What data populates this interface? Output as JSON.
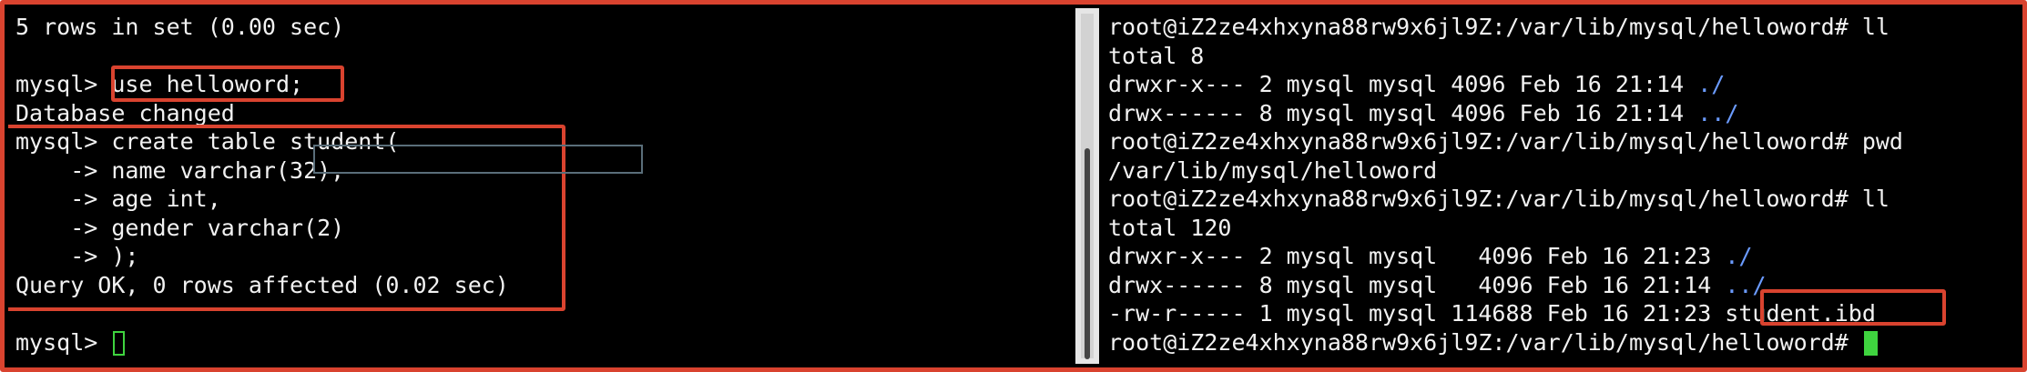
{
  "left_terminal": {
    "lines": [
      "5 rows in set (0.00 sec)",
      "",
      "mysql> use helloword;",
      "Database changed",
      "mysql> create table student(",
      "    -> name varchar(32),",
      "    -> age int,",
      "    -> gender varchar(2)",
      "    -> );",
      "Query OK, 0 rows affected (0.02 sec)",
      "",
      "mysql> "
    ]
  },
  "right_terminal": {
    "lines": [
      "root@iZ2ze4xhxyna88rw9x6jl9Z:/var/lib/mysql/helloword# ll",
      "total 8",
      "drwxr-x--- 2 mysql mysql 4096 Feb 16 21:14 ",
      "drwx------ 8 mysql mysql 4096 Feb 16 21:14 ",
      "root@iZ2ze4xhxyna88rw9x6jl9Z:/var/lib/mysql/helloword# pwd",
      "/var/lib/mysql/helloword",
      "root@iZ2ze4xhxyna88rw9x6jl9Z:/var/lib/mysql/helloword# ll",
      "total 120",
      "drwxr-x--- 2 mysql mysql   4096 Feb 16 21:23 ",
      "drwx------ 8 mysql mysql   4096 Feb 16 21:14 ",
      "-rw-r----- 1 mysql mysql 114688 Feb 16 21:23 student.ibd",
      "root@iZ2ze4xhxyna88rw9x6jl9Z:/var/lib/mysql/helloword# "
    ],
    "dir_links": {
      "l2": "./",
      "l3": "../",
      "l8": "./",
      "l9": "../"
    }
  },
  "colors": {
    "highlight": "#d9432f",
    "cursor": "#3fd43f",
    "dir": "#6b9bff"
  }
}
